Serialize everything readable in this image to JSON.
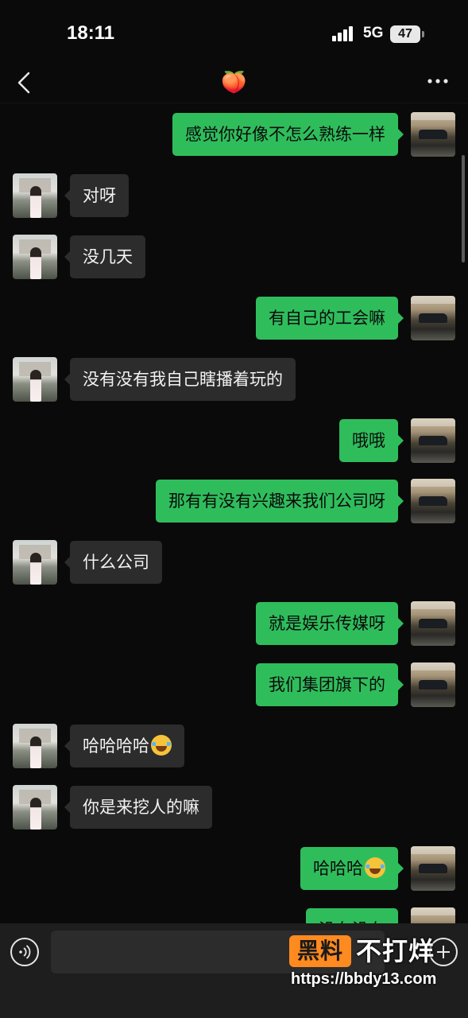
{
  "status_bar": {
    "time": "18:11",
    "network": "5G",
    "battery": "47"
  },
  "nav": {
    "title": "🍑"
  },
  "messages": [
    {
      "sender": "me",
      "text": "感觉你好像不怎么熟练一样"
    },
    {
      "sender": "them",
      "text": "对呀"
    },
    {
      "sender": "them",
      "text": "没几天"
    },
    {
      "sender": "me",
      "text": "有自己的工会嘛"
    },
    {
      "sender": "them",
      "text": "没有没有我自己瞎播着玩的"
    },
    {
      "sender": "me",
      "text": "哦哦"
    },
    {
      "sender": "me",
      "text": "那有有没有兴趣来我们公司呀"
    },
    {
      "sender": "them",
      "text": "什么公司"
    },
    {
      "sender": "me",
      "text": "就是娱乐传媒呀"
    },
    {
      "sender": "me",
      "text": "我们集团旗下的"
    },
    {
      "sender": "them",
      "text": "哈哈哈哈",
      "emoji": "laughing-tears"
    },
    {
      "sender": "them",
      "text": "你是来挖人的嘛"
    },
    {
      "sender": "me",
      "text": "哈哈哈",
      "emoji": "laughing-tears"
    },
    {
      "sender": "me",
      "text": "没有没有"
    }
  ],
  "input_bar": {
    "value": ""
  },
  "watermark": {
    "brand": "黑料",
    "tagline": "不打烊",
    "url": "https://bbdy13.com"
  },
  "colors": {
    "my_bubble": "#2fbd5c",
    "their_bubble": "#2c2c2c",
    "background": "#0a0a0a"
  }
}
